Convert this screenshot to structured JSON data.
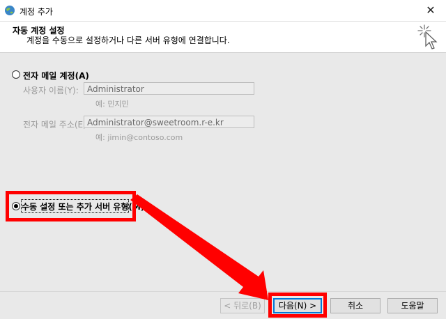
{
  "window": {
    "title": "계정 추가",
    "close_glyph": "✕"
  },
  "header": {
    "title": "자동 계정 설정",
    "subtitle": "계정을 수동으로 설정하거나 다른 서버 유형에 연결합니다."
  },
  "options": {
    "email_account": {
      "label": "전자 메일 계정(A)",
      "selected": false
    },
    "manual_setup": {
      "label": "수동 설정 또는 추가 서버 유형(M)",
      "selected": true
    }
  },
  "fields": {
    "name": {
      "label": "사용자 이름(Y):",
      "value": "Administrator",
      "hint": "예: 민지민"
    },
    "email": {
      "label": "전자 메일 주소(E):",
      "value": "Administrator@sweetroom.r-e.kr",
      "hint": "예: jimin@contoso.com"
    }
  },
  "buttons": {
    "back": "< 뒤로(B)",
    "next": "다음(N) >",
    "cancel": "취소",
    "help": "도움말"
  },
  "icons": {
    "window": "globe-icon",
    "header": "wizard-sparkle-icon"
  },
  "colors": {
    "highlight": "#ff0000",
    "accent": "#0078d7"
  }
}
